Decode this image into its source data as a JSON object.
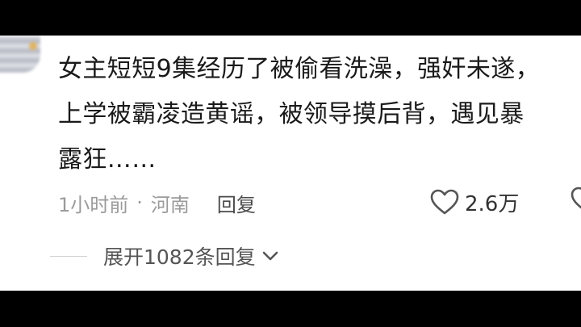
{
  "comment": {
    "lines": [
      "女主短短9集经历了被偷看洗澡，强奸未遂，",
      "上学被霸凌造黄谣，被领导摸后背，遇见暴",
      "露狂……"
    ],
    "time": "1小时前",
    "separator": "·",
    "location": "河南",
    "reply_label": "回复",
    "like_count": "2.6万",
    "like_icon": "heart-outline-icon",
    "dislike_icon": "heart-outline-icon"
  },
  "replies": {
    "expand_label": "展开1082条回复",
    "expand_icon": "chevron-down-icon"
  },
  "colors": {
    "background": "#000000",
    "card": "#ffffff",
    "text": "#1a1a1a",
    "meta": "#9b9b9b"
  }
}
